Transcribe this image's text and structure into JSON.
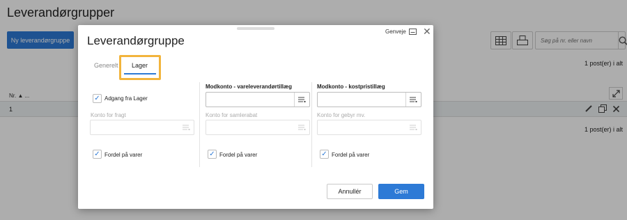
{
  "page": {
    "title": "Leverandørgrupper",
    "new_button": "Ny leverandørgruppe",
    "search_placeholder": "Søg på nr. eller navn",
    "count_top": "1 post(er) i alt",
    "count_bottom": "1 post(er) i alt",
    "column_header": "Nr. ▲ ...",
    "row_number": "1"
  },
  "dialog": {
    "title": "Leverandørgruppe",
    "shortcuts": "Genveje",
    "tabs": [
      {
        "label": "Generelt",
        "active": false
      },
      {
        "label": "Lager",
        "active": true
      }
    ],
    "col1": {
      "checkbox1_label": "Adgang fra Lager",
      "checkbox1_checked": true,
      "field_label": "Konto for fragt",
      "field_value": "",
      "checkbox2_label": "Fordel på varer",
      "checkbox2_checked": true
    },
    "col2": {
      "field1_label": "Modkonto - vareleverandørtillæg",
      "field1_value": "",
      "field2_label": "Konto for samlerabat",
      "field2_value": "",
      "checkbox_label": "Fordel på varer",
      "checkbox_checked": true
    },
    "col3": {
      "field1_label": "Modkonto - kostpristillæg",
      "field1_value": "",
      "field2_label": "Konto for gebyr mv.",
      "field2_value": "",
      "checkbox_label": "Fordel på varer",
      "checkbox_checked": true
    },
    "cancel": "Annullér",
    "save": "Gem"
  },
  "colors": {
    "accent": "#2d7ad6",
    "highlight": "#f2b43c"
  }
}
